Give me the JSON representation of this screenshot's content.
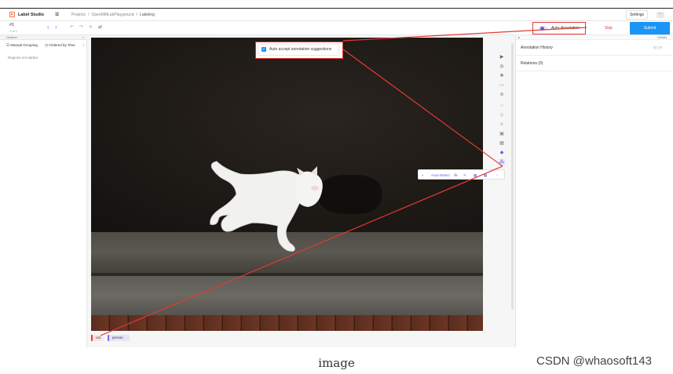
{
  "app": {
    "brand": "Label Studio"
  },
  "breadcrumb": {
    "items": [
      "Projects",
      "OpenMMLabPlayground",
      "Labeling"
    ]
  },
  "header": {
    "settings_label": "Settings",
    "more_label": "···"
  },
  "toolbar": {
    "task_id": "#1",
    "task_count": "1 of 1",
    "auto_annotation_label": "Auto-Annotation",
    "skip_label": "Skip",
    "submit_label": "Submit"
  },
  "sidebar": {
    "title": "Outliner",
    "manual_grouping": "Manual Grouping",
    "ordered_by": "Ordered by Time",
    "empty_text": "Regions not added"
  },
  "auto_accept": {
    "label": "Auto accept annotation suggestions",
    "checked": true
  },
  "auto_detect": {
    "label": "Auto-Detect"
  },
  "labels": [
    {
      "text": "cat",
      "color": "#e53935"
    },
    {
      "text": "person",
      "color": "#7b6cf0"
    }
  ],
  "right_panel": {
    "details_label": "Details",
    "annotation_history": "Annotation History",
    "history_shortcut": "ƦƒƒƦ",
    "relations": "Relations (0)"
  },
  "colors": {
    "accent": "#1a95f5",
    "highlight": "#e53935",
    "brand": "#f5743a"
  },
  "caption": "image",
  "watermark": "CSDN @whaosoft143"
}
